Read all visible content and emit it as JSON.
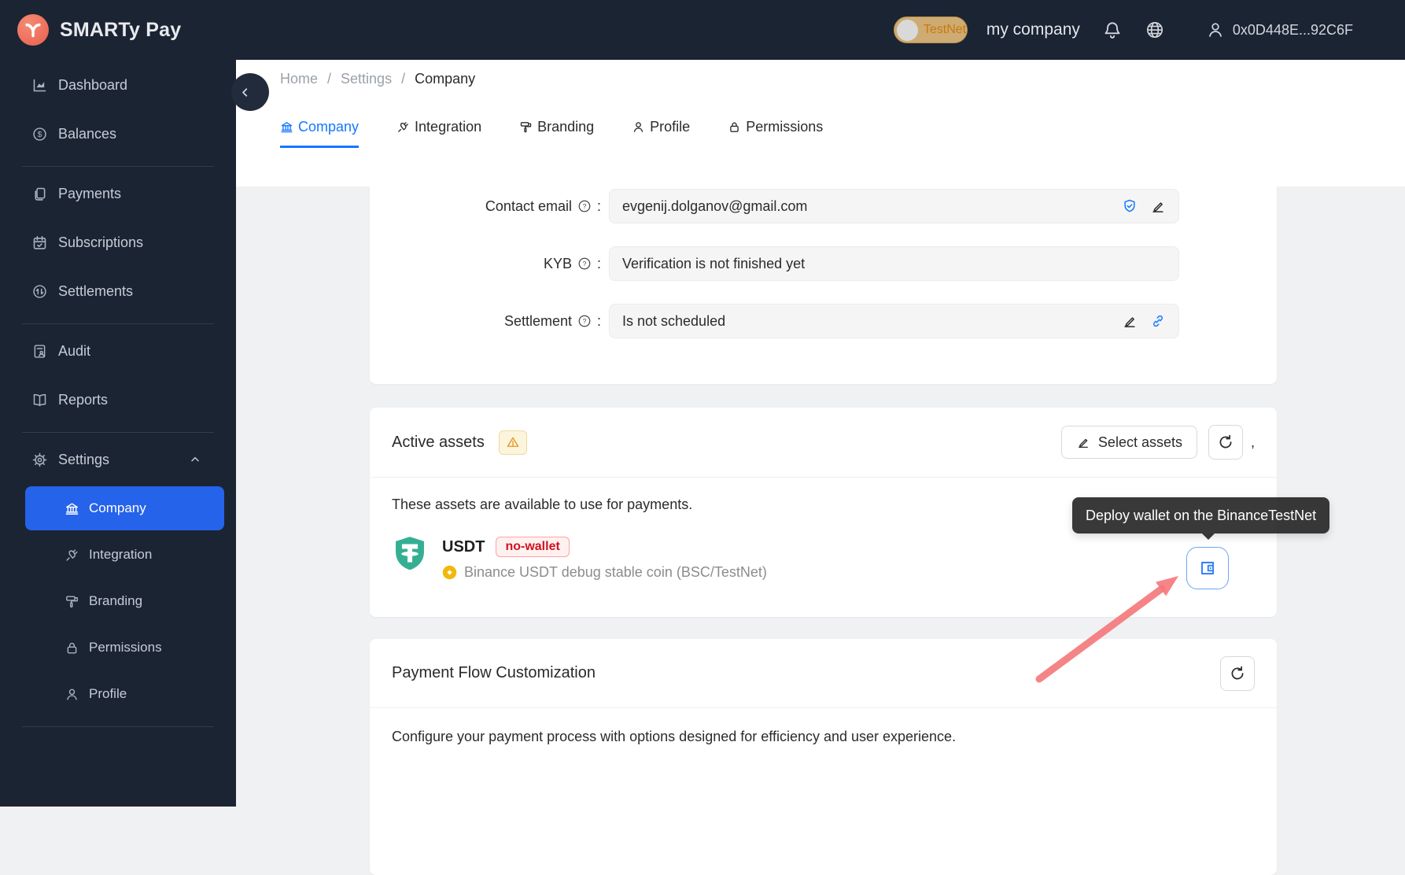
{
  "brand": {
    "name": "SMARTy Pay"
  },
  "header": {
    "testnet_toggle_label": "TestNet",
    "company_name": "my company",
    "account_address": "0x0D448E...92C6F"
  },
  "sidebar": {
    "items": [
      {
        "label": "Dashboard",
        "icon": "dashboard-icon"
      },
      {
        "label": "Balances",
        "icon": "balances-icon"
      },
      {
        "label": "Payments",
        "icon": "payments-icon"
      },
      {
        "label": "Subscriptions",
        "icon": "subscriptions-icon"
      },
      {
        "label": "Settlements",
        "icon": "settlements-icon"
      },
      {
        "label": "Audit",
        "icon": "audit-icon"
      },
      {
        "label": "Reports",
        "icon": "reports-icon"
      },
      {
        "label": "Settings",
        "icon": "settings-gear-icon"
      }
    ],
    "settings_children": [
      {
        "label": "Company",
        "icon": "bank-icon",
        "active": true
      },
      {
        "label": "Integration",
        "icon": "plug-icon"
      },
      {
        "label": "Branding",
        "icon": "paint-roller-icon"
      },
      {
        "label": "Permissions",
        "icon": "lock-icon"
      },
      {
        "label": "Profile",
        "icon": "person-icon"
      }
    ]
  },
  "breadcrumb": {
    "separator": "/",
    "items": [
      "Home",
      "Settings",
      "Company"
    ]
  },
  "tabs": [
    {
      "label": "Company",
      "icon": "bank-icon",
      "active": true
    },
    {
      "label": "Integration",
      "icon": "plug-icon"
    },
    {
      "label": "Branding",
      "icon": "paint-roller-icon"
    },
    {
      "label": "Profile",
      "icon": "person-icon"
    },
    {
      "label": "Permissions",
      "icon": "lock-icon"
    }
  ],
  "glyphs": {
    "help_symbol": "?",
    "colon": ":",
    "currency_symbol": "$"
  },
  "company_form": {
    "fields": [
      {
        "label": "Contact email",
        "value": "evgenij.dolganov@gmail.com"
      },
      {
        "label": "KYB",
        "value": "Verification is not finished yet"
      },
      {
        "label": "Settlement",
        "value": "Is not scheduled"
      }
    ]
  },
  "active_assets": {
    "title": "Active assets",
    "select_assets_label": "Select assets",
    "trailing_comma": ",",
    "description": "These assets are available to use for payments.",
    "asset": {
      "symbol": "USDT",
      "badge": "no-wallet",
      "description": "Binance USDT debug stable coin (BSC/TestNet)"
    },
    "tooltip": "Deploy wallet on the BinanceTestNet"
  },
  "payment_flow": {
    "title": "Payment Flow Customization",
    "description": "Configure your payment process with options designed for efficiency and user experience."
  },
  "colors": {
    "header_bg": "#1b2433",
    "sidebar_active_bg": "#2563eb",
    "tab_active": "#1677ff",
    "testnet_text": "#c8790e",
    "error_badge_text": "#cf1322",
    "warning_icon": "#dd9a26",
    "tether_teal": "#35af93",
    "binance_yellow": "#f0b90b",
    "deploy_border": "#6ba6f8",
    "arrow_red": "#f5777b"
  }
}
